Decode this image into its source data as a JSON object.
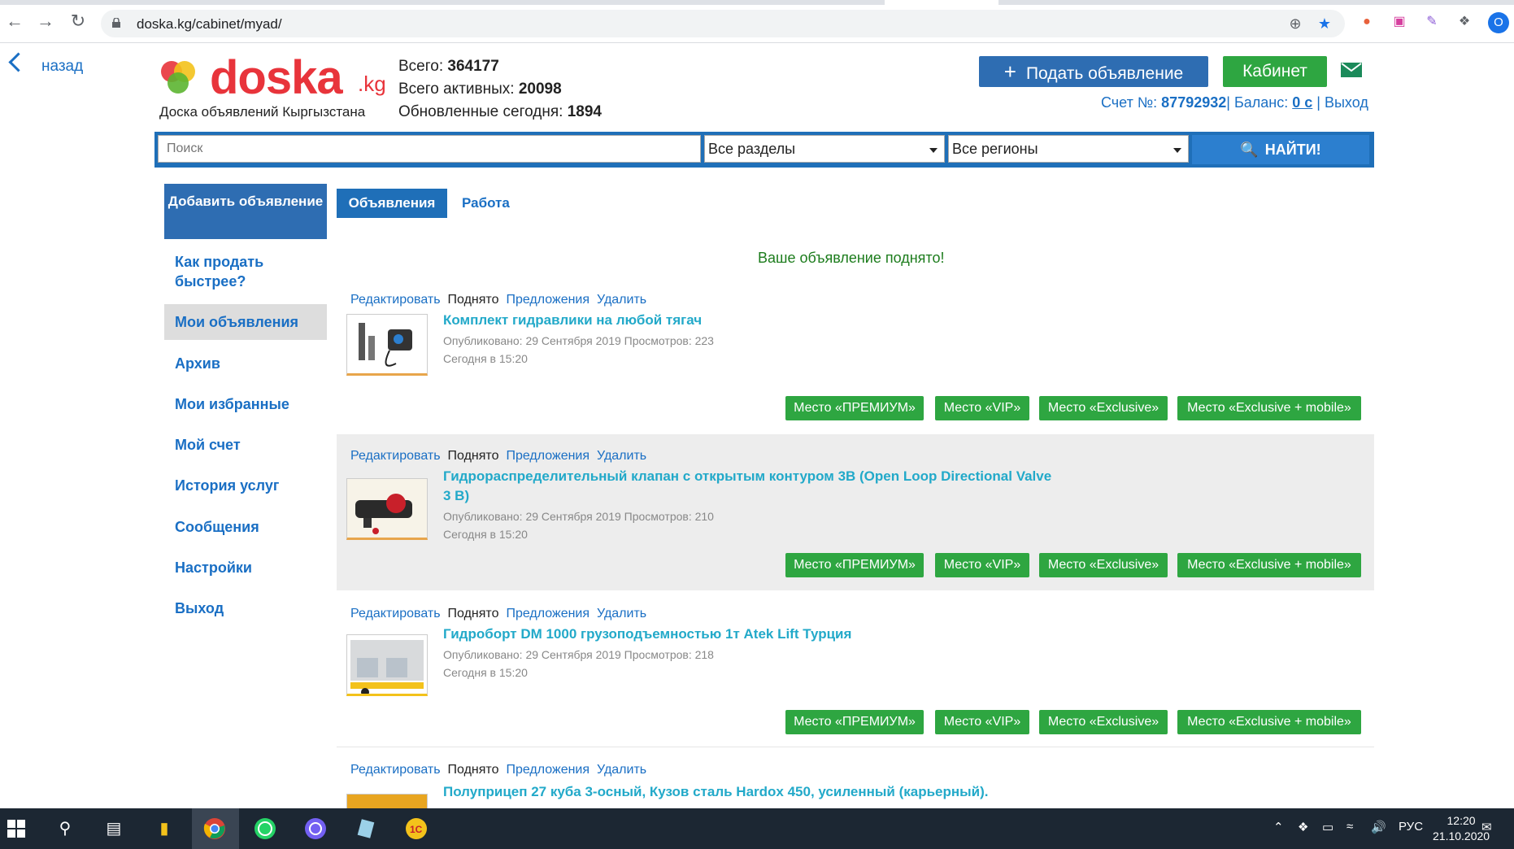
{
  "browser": {
    "url": "doska.kg/cabinet/myad/",
    "profile_initial": "O"
  },
  "header": {
    "back_label": "назад",
    "logo_text": "doska",
    "logo_suffix": ".kg",
    "logo_subtitle": "Доска объявлений Кыргызстана",
    "stats": {
      "total_label": "Всего:",
      "total_value": "364177",
      "active_label": "Всего активных:",
      "active_value": "20098",
      "updated_label": "Обновленные сегодня:",
      "updated_value": "1894"
    },
    "post_ad_label": "Подать объявление",
    "cabinet_label": "Кабинет",
    "account": {
      "account_label": "Счет №:",
      "account_number": "87792932",
      "balance_label": "| Баланс:",
      "balance_value": "0 с",
      "logout_label": "| Выход"
    }
  },
  "search": {
    "placeholder": "Поиск",
    "section_value": "Все разделы",
    "region_value": "Все регионы",
    "find_label": "НАЙТИ!"
  },
  "sidebar": {
    "add_button": "Добавить объявление",
    "items": [
      {
        "label": "Как продать быстрее?"
      },
      {
        "label": "Мои объявления"
      },
      {
        "label": "Архив"
      },
      {
        "label": "Мои избранные"
      },
      {
        "label": "Мой счет"
      },
      {
        "label": "История услуг"
      },
      {
        "label": "Сообщения"
      },
      {
        "label": "Настройки"
      },
      {
        "label": "Выход"
      }
    ]
  },
  "tabs": {
    "ads": "Объявления",
    "work": "Работа"
  },
  "notice": "Ваше объявление поднято!",
  "listing_actions": {
    "edit": "Редактировать",
    "raised": "Поднято",
    "offers": "Предложения",
    "delete": "Удалить"
  },
  "promo_labels": {
    "premium": "Место «ПРЕМИУМ»",
    "vip": "Место «VIP»",
    "exclusive": "Место «Exclusive»",
    "exclusive_mobile": "Место «Exclusive + mobile»"
  },
  "listings": [
    {
      "title": "Комплект гидравлики на любой тягач",
      "published": "Опубликовано: 29 Сентября 2019 Просмотров: 223",
      "raised_at": "Сегодня в 15:20"
    },
    {
      "title": "Гидрораспределительный клапан с открытым контуром 3В (Open Loop Directional Valve 3 В)",
      "published": "Опубликовано: 29 Сентября 2019 Просмотров: 210",
      "raised_at": "Сегодня в 15:20"
    },
    {
      "title": "Гидроборт DM 1000 грузоподъемностью 1т Atek Lift Турция",
      "published": "Опубликовано: 29 Сентября 2019 Просмотров: 218",
      "raised_at": "Сегодня в 15:20"
    },
    {
      "title": "Полуприцеп 27 куба 3-осный, Кузов сталь Hardox 450, усиленный (карьерный).",
      "published": "",
      "raised_at": ""
    }
  ],
  "taskbar": {
    "language": "РУС",
    "time": "12:20",
    "date": "21.10.2020"
  },
  "colors": {
    "brand_blue": "#2e6db2",
    "brand_green": "#2ea641",
    "logo_red": "#e8343b",
    "link_blue": "#1a6fc4",
    "title_cyan": "#22a9c9"
  }
}
